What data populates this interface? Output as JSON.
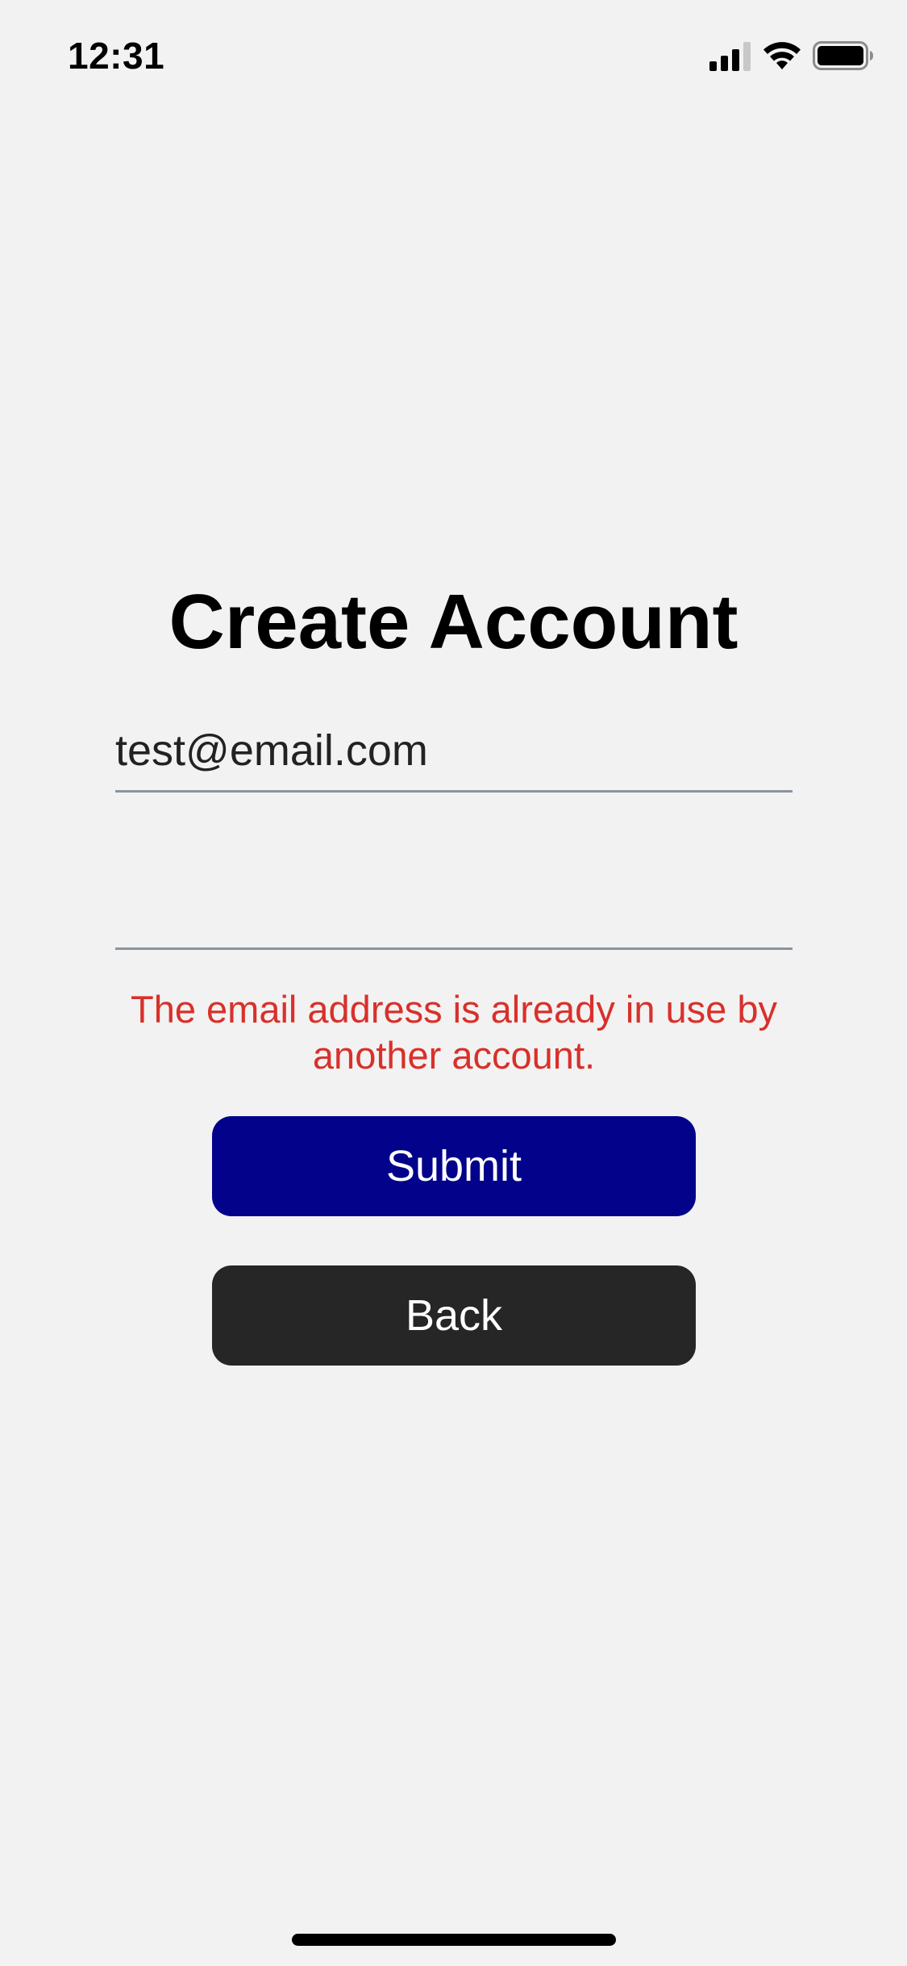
{
  "status_bar": {
    "time": "12:31",
    "icons": [
      "cellular-signal-icon",
      "wifi-icon",
      "battery-icon"
    ]
  },
  "form": {
    "title": "Create Account",
    "email_value": "test@email.com",
    "password_value": "",
    "error_message": "The email address is already in use by another account.",
    "submit_label": "Submit",
    "back_label": "Back"
  },
  "colors": {
    "background": "#f2f2f2",
    "error": "#d9302a",
    "submit_button": "#02028a",
    "back_button": "#262626",
    "field_underline": "#8a949e"
  }
}
